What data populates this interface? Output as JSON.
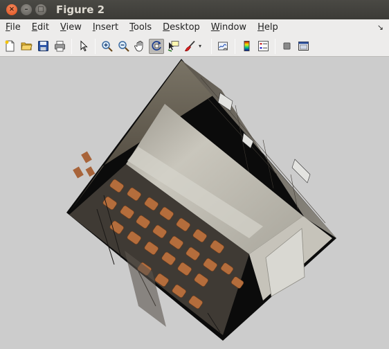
{
  "window": {
    "title": "Figure 2",
    "close_glyph": "×",
    "min_glyph": "–",
    "max_glyph": "□"
  },
  "menubar": {
    "items": [
      {
        "label": "File",
        "mnemonic": "F",
        "rest": "ile"
      },
      {
        "label": "Edit",
        "mnemonic": "E",
        "rest": "dit"
      },
      {
        "label": "View",
        "mnemonic": "V",
        "rest": "iew"
      },
      {
        "label": "Insert",
        "mnemonic": "I",
        "rest": "nsert"
      },
      {
        "label": "Tools",
        "mnemonic": "T",
        "rest": "ools"
      },
      {
        "label": "Desktop",
        "mnemonic": "D",
        "rest": "esktop"
      },
      {
        "label": "Window",
        "mnemonic": "W",
        "rest": "indow"
      },
      {
        "label": "Help",
        "mnemonic": "H",
        "rest": "elp"
      }
    ],
    "dock_glyph": "↘"
  },
  "toolbar": {
    "active_tool": "rotate-3d",
    "dropdown_glyph": "▾",
    "buttons": [
      {
        "icon": "new-figure-icon"
      },
      {
        "icon": "open-file-icon"
      },
      {
        "icon": "save-icon"
      },
      {
        "icon": "print-icon"
      },
      {
        "icon": "edit-plot-icon"
      },
      {
        "icon": "zoom-in-icon"
      },
      {
        "icon": "zoom-out-icon"
      },
      {
        "icon": "pan-icon"
      },
      {
        "icon": "rotate-3d-icon"
      },
      {
        "icon": "data-cursor-icon"
      },
      {
        "icon": "brush-icon"
      },
      {
        "icon": "link-plot-icon"
      },
      {
        "icon": "colorbar-icon"
      },
      {
        "icon": "legend-icon"
      },
      {
        "icon": "hide-plot-tools-icon"
      },
      {
        "icon": "show-plot-tools-icon"
      }
    ]
  },
  "figure": {
    "background": "#cccccc",
    "content": "3D textured cube showing classroom photo",
    "colors": {
      "top_face": "#b9b6ac",
      "left_face": "#5f5a50",
      "right_face": "#7d7a72",
      "chairs": "#b06a3a",
      "edge": "#0b0b0b"
    }
  }
}
